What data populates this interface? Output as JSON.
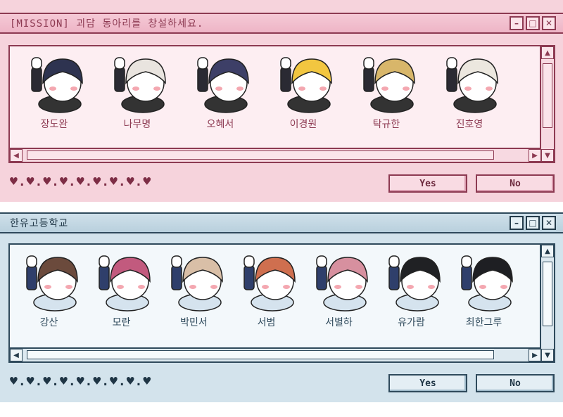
{
  "windows": [
    {
      "id": "pink",
      "title": "[MISSION] 괴담 동아리를 창설하세요.",
      "controls": {
        "minimize": "–",
        "maximize": "□",
        "close": "✕"
      },
      "characters": [
        "장도완",
        "나무명",
        "오혜서",
        "이경원",
        "탁규한",
        "진호영"
      ],
      "hearts": "♥.♥.♥.♥.♥.♥.♥.♥.♥",
      "buttons": {
        "yes": "Yes",
        "no": "No"
      },
      "colors": {
        "accent": "#8d3a52",
        "background": "#f6d3dc"
      }
    },
    {
      "id": "blue",
      "title": "한유고등학교",
      "controls": {
        "minimize": "–",
        "maximize": "□",
        "close": "✕"
      },
      "characters": [
        "강산",
        "모란",
        "박민서",
        "서범",
        "서별하",
        "유가람",
        "최한그루"
      ],
      "hearts": "♥.♥.♥.♥.♥.♥.♥.♥.♥",
      "buttons": {
        "yes": "Yes",
        "no": "No"
      },
      "colors": {
        "accent": "#2f4a5c",
        "background": "#d3e3ec"
      }
    }
  ],
  "scrollbar_icons": {
    "up": "▲",
    "down": "▼",
    "left": "◀",
    "right": "▶"
  },
  "character_hair": {
    "pink": [
      "#2e3350",
      "#e9e4df",
      "#3d3f67",
      "#f2c640",
      "#d8b66a",
      "#ece7df"
    ],
    "blue": [
      "#6b4a3c",
      "#c25a7e",
      "#d9bfa7",
      "#cf6f4f",
      "#d7909f",
      "#202124",
      "#1e1f23"
    ]
  }
}
